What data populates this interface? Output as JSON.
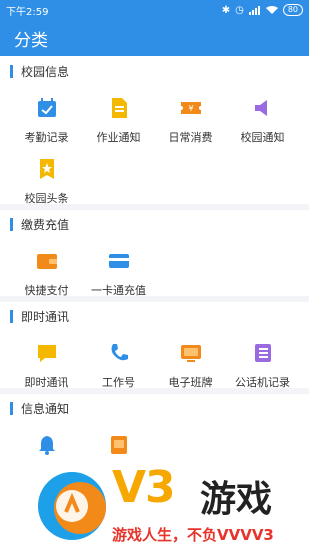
{
  "status_bar": {
    "time": "下午2:59",
    "battery": "80"
  },
  "app_bar": {
    "title": "分类"
  },
  "sections": [
    {
      "title": "校园信息",
      "items": [
        {
          "label": "考勤记录",
          "icon": "calendar-check-icon",
          "color": "#2f8fe6"
        },
        {
          "label": "作业通知",
          "icon": "document-icon",
          "color": "#f5b800"
        },
        {
          "label": "日常消费",
          "icon": "ticket-icon",
          "color": "#f28a1a"
        },
        {
          "label": "校园通知",
          "icon": "speaker-icon",
          "color": "#9a6be0"
        },
        {
          "label": "校园头条",
          "icon": "star-badge-icon",
          "color": "#f5b800"
        }
      ]
    },
    {
      "title": "缴费充值",
      "items": [
        {
          "label": "快捷支付",
          "icon": "wallet-icon",
          "color": "#f28a1a"
        },
        {
          "label": "一卡通充值",
          "icon": "card-icon",
          "color": "#2f8fe6"
        }
      ]
    },
    {
      "title": "即时通讯",
      "items": [
        {
          "label": "即时通讯",
          "icon": "chat-icon",
          "color": "#f5b800"
        },
        {
          "label": "工作号",
          "icon": "phone-icon",
          "color": "#2f8fe6"
        },
        {
          "label": "电子班牌",
          "icon": "tv-icon",
          "color": "#f28a1a"
        },
        {
          "label": "公话机记录",
          "icon": "phone-book-icon",
          "color": "#9a6be0"
        }
      ]
    },
    {
      "title": "信息通知",
      "items": [
        {
          "label": "",
          "icon": "bell-icon",
          "color": "#2f8fe6"
        },
        {
          "label": "",
          "icon": "score-100-icon",
          "color": "#f28a1a"
        }
      ]
    }
  ],
  "watermark": {
    "brand": "V3",
    "name": "游戏",
    "slogan": "游戏人生，不负VVVV3"
  }
}
